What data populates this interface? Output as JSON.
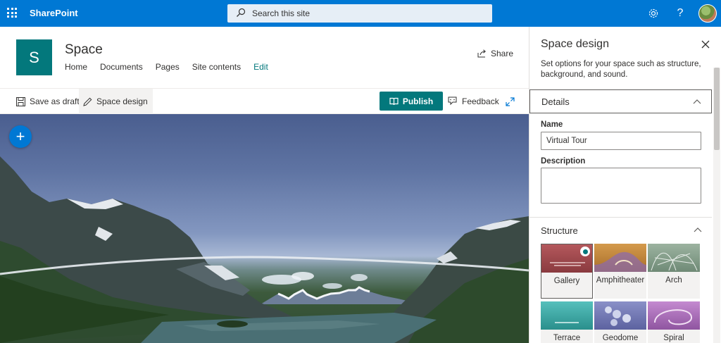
{
  "suitebar": {
    "brand": "SharePoint",
    "search_placeholder": "Search this site",
    "accent": "#0078d4"
  },
  "site": {
    "logo_letter": "S",
    "title": "Space",
    "nav": [
      "Home",
      "Documents",
      "Pages",
      "Site contents",
      "Edit"
    ],
    "share_label": "Share",
    "theme_color": "#03787c"
  },
  "toolbar": {
    "save_draft": "Save as draft",
    "space_design": "Space design",
    "publish": "Publish",
    "feedback": "Feedback"
  },
  "panel": {
    "title": "Space design",
    "description": "Set options for your space such as structure, background, and sound.",
    "details_heading": "Details",
    "name_label": "Name",
    "name_value": "Virtual Tour",
    "description_label": "Description",
    "description_value": "",
    "structure_heading": "Structure",
    "structures": [
      {
        "label": "Gallery",
        "selected": true,
        "color": "#a2494e"
      },
      {
        "label": "Amphitheater",
        "selected": false,
        "color": "#c98a3a"
      },
      {
        "label": "Arch",
        "selected": false,
        "color": "#7f9a86"
      },
      {
        "label": "Terrace",
        "selected": false,
        "color": "#3aa8a6"
      },
      {
        "label": "Geodome",
        "selected": false,
        "color": "#6f78b4"
      },
      {
        "label": "Spiral",
        "selected": false,
        "color": "#9a5fa8"
      }
    ]
  }
}
